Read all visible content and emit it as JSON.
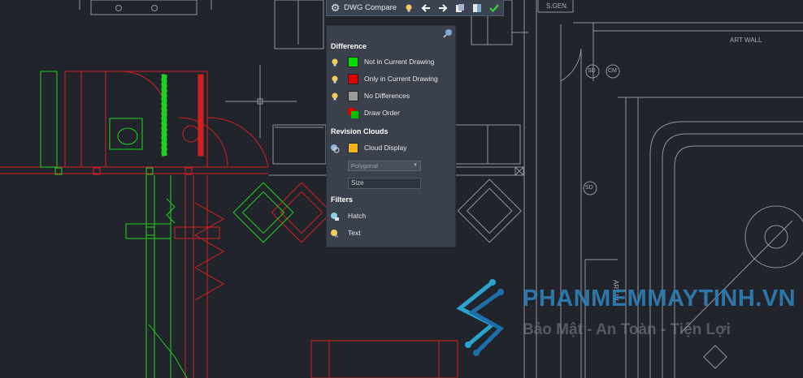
{
  "toolbar": {
    "title": "DWG Compare",
    "buttons": [
      "settings",
      "toggle-highlight",
      "previous-change",
      "next-change",
      "snapshot",
      "export",
      "done"
    ]
  },
  "panel": {
    "difference_header": "Difference",
    "not_in_current": "Not in Current Drawing",
    "only_in_current": "Only in Current Drawing",
    "no_differences": "No Differences",
    "draw_order": "Draw Order",
    "revision_clouds_header": "Revision Clouds",
    "cloud_display": "Cloud Display",
    "cloud_shape": "Polygonal",
    "size_label": "Size",
    "filters_header": "Filters",
    "hatch": "Hatch",
    "text": "Text"
  },
  "colors": {
    "not_in_current": "#00e000",
    "only_in_current": "#e00000",
    "no_differences": "#9a9a9a",
    "cloud_display": "#f2b21a",
    "cad_lines": "#8e949b",
    "panel_bg": "#3a414c"
  },
  "drawing_labels": {
    "s_gen": "S.GEN.",
    "art_wall_top": "ART WALL",
    "art_wall_side": "ART W",
    "sd_a": "SD",
    "cm": "CM",
    "sd_b": "SD"
  },
  "watermark": {
    "title": "PHANMEMMAYTINH.VN",
    "subtitle": "Bảo Mật - An Toàn - Tiện Lợi"
  }
}
